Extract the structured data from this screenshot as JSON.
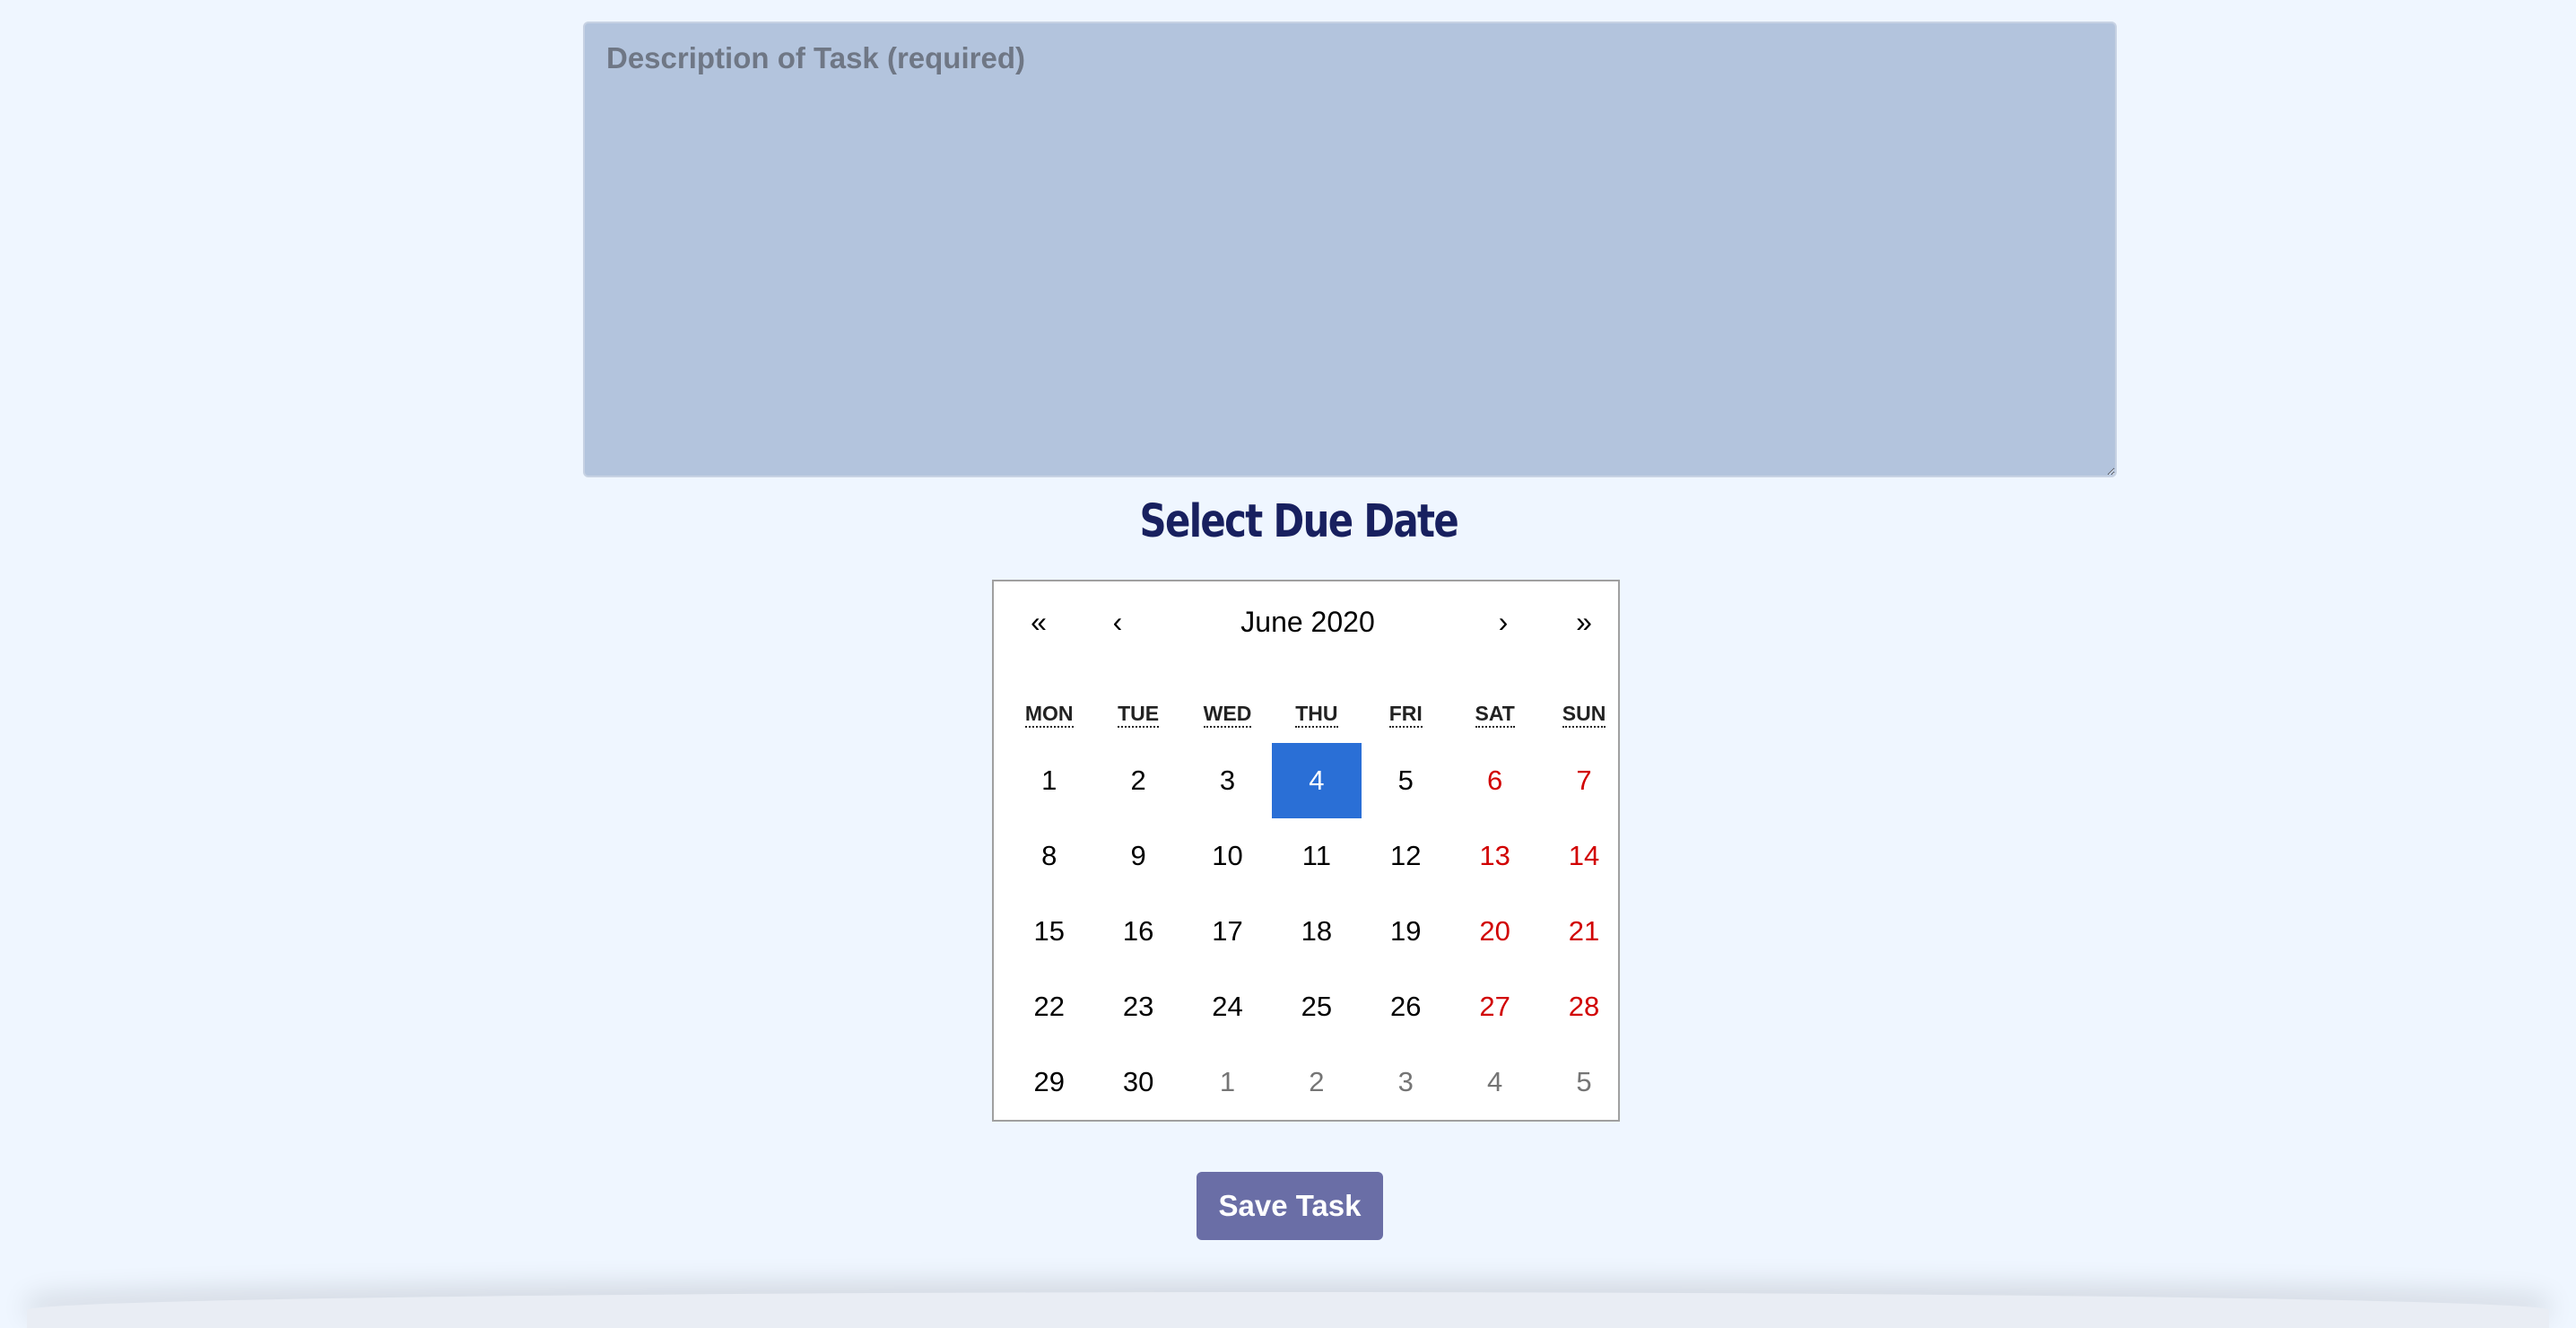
{
  "form": {
    "description_placeholder": "Description of Task (required)",
    "description_value": "",
    "due_heading": "Select Due Date",
    "save_label": "Save Task"
  },
  "calendar": {
    "nav": {
      "prev2": "«",
      "prev": "‹",
      "label": "June 2020",
      "next": "›",
      "next2": "»"
    },
    "weekdays": [
      "MON",
      "TUE",
      "WED",
      "THU",
      "FRI",
      "SAT",
      "SUN"
    ],
    "selected_day": "4",
    "days": [
      {
        "label": "1",
        "kind": "weekday"
      },
      {
        "label": "2",
        "kind": "weekday"
      },
      {
        "label": "3",
        "kind": "weekday"
      },
      {
        "label": "4",
        "kind": "selected"
      },
      {
        "label": "5",
        "kind": "weekday"
      },
      {
        "label": "6",
        "kind": "weekend"
      },
      {
        "label": "7",
        "kind": "weekend"
      },
      {
        "label": "8",
        "kind": "weekday"
      },
      {
        "label": "9",
        "kind": "weekday"
      },
      {
        "label": "10",
        "kind": "weekday"
      },
      {
        "label": "11",
        "kind": "weekday"
      },
      {
        "label": "12",
        "kind": "weekday"
      },
      {
        "label": "13",
        "kind": "weekend"
      },
      {
        "label": "14",
        "kind": "weekend"
      },
      {
        "label": "15",
        "kind": "weekday"
      },
      {
        "label": "16",
        "kind": "weekday"
      },
      {
        "label": "17",
        "kind": "weekday"
      },
      {
        "label": "18",
        "kind": "weekday"
      },
      {
        "label": "19",
        "kind": "weekday"
      },
      {
        "label": "20",
        "kind": "weekend"
      },
      {
        "label": "21",
        "kind": "weekend"
      },
      {
        "label": "22",
        "kind": "weekday"
      },
      {
        "label": "23",
        "kind": "weekday"
      },
      {
        "label": "24",
        "kind": "weekday"
      },
      {
        "label": "25",
        "kind": "weekday"
      },
      {
        "label": "26",
        "kind": "weekday"
      },
      {
        "label": "27",
        "kind": "weekend"
      },
      {
        "label": "28",
        "kind": "weekend"
      },
      {
        "label": "29",
        "kind": "weekday"
      },
      {
        "label": "30",
        "kind": "weekday"
      },
      {
        "label": "1",
        "kind": "neighbor"
      },
      {
        "label": "2",
        "kind": "neighbor"
      },
      {
        "label": "3",
        "kind": "neighbor"
      },
      {
        "label": "4",
        "kind": "neighbor"
      },
      {
        "label": "5",
        "kind": "neighbor"
      }
    ]
  },
  "colors": {
    "background": "#eff6ff",
    "textarea_bg": "#b3c4dd",
    "heading": "#18205f",
    "selected_day_bg": "#2a6fd6",
    "weekend_text": "#d10000",
    "neighbor_text": "#757575",
    "save_button_bg": "#6a6ea6"
  }
}
